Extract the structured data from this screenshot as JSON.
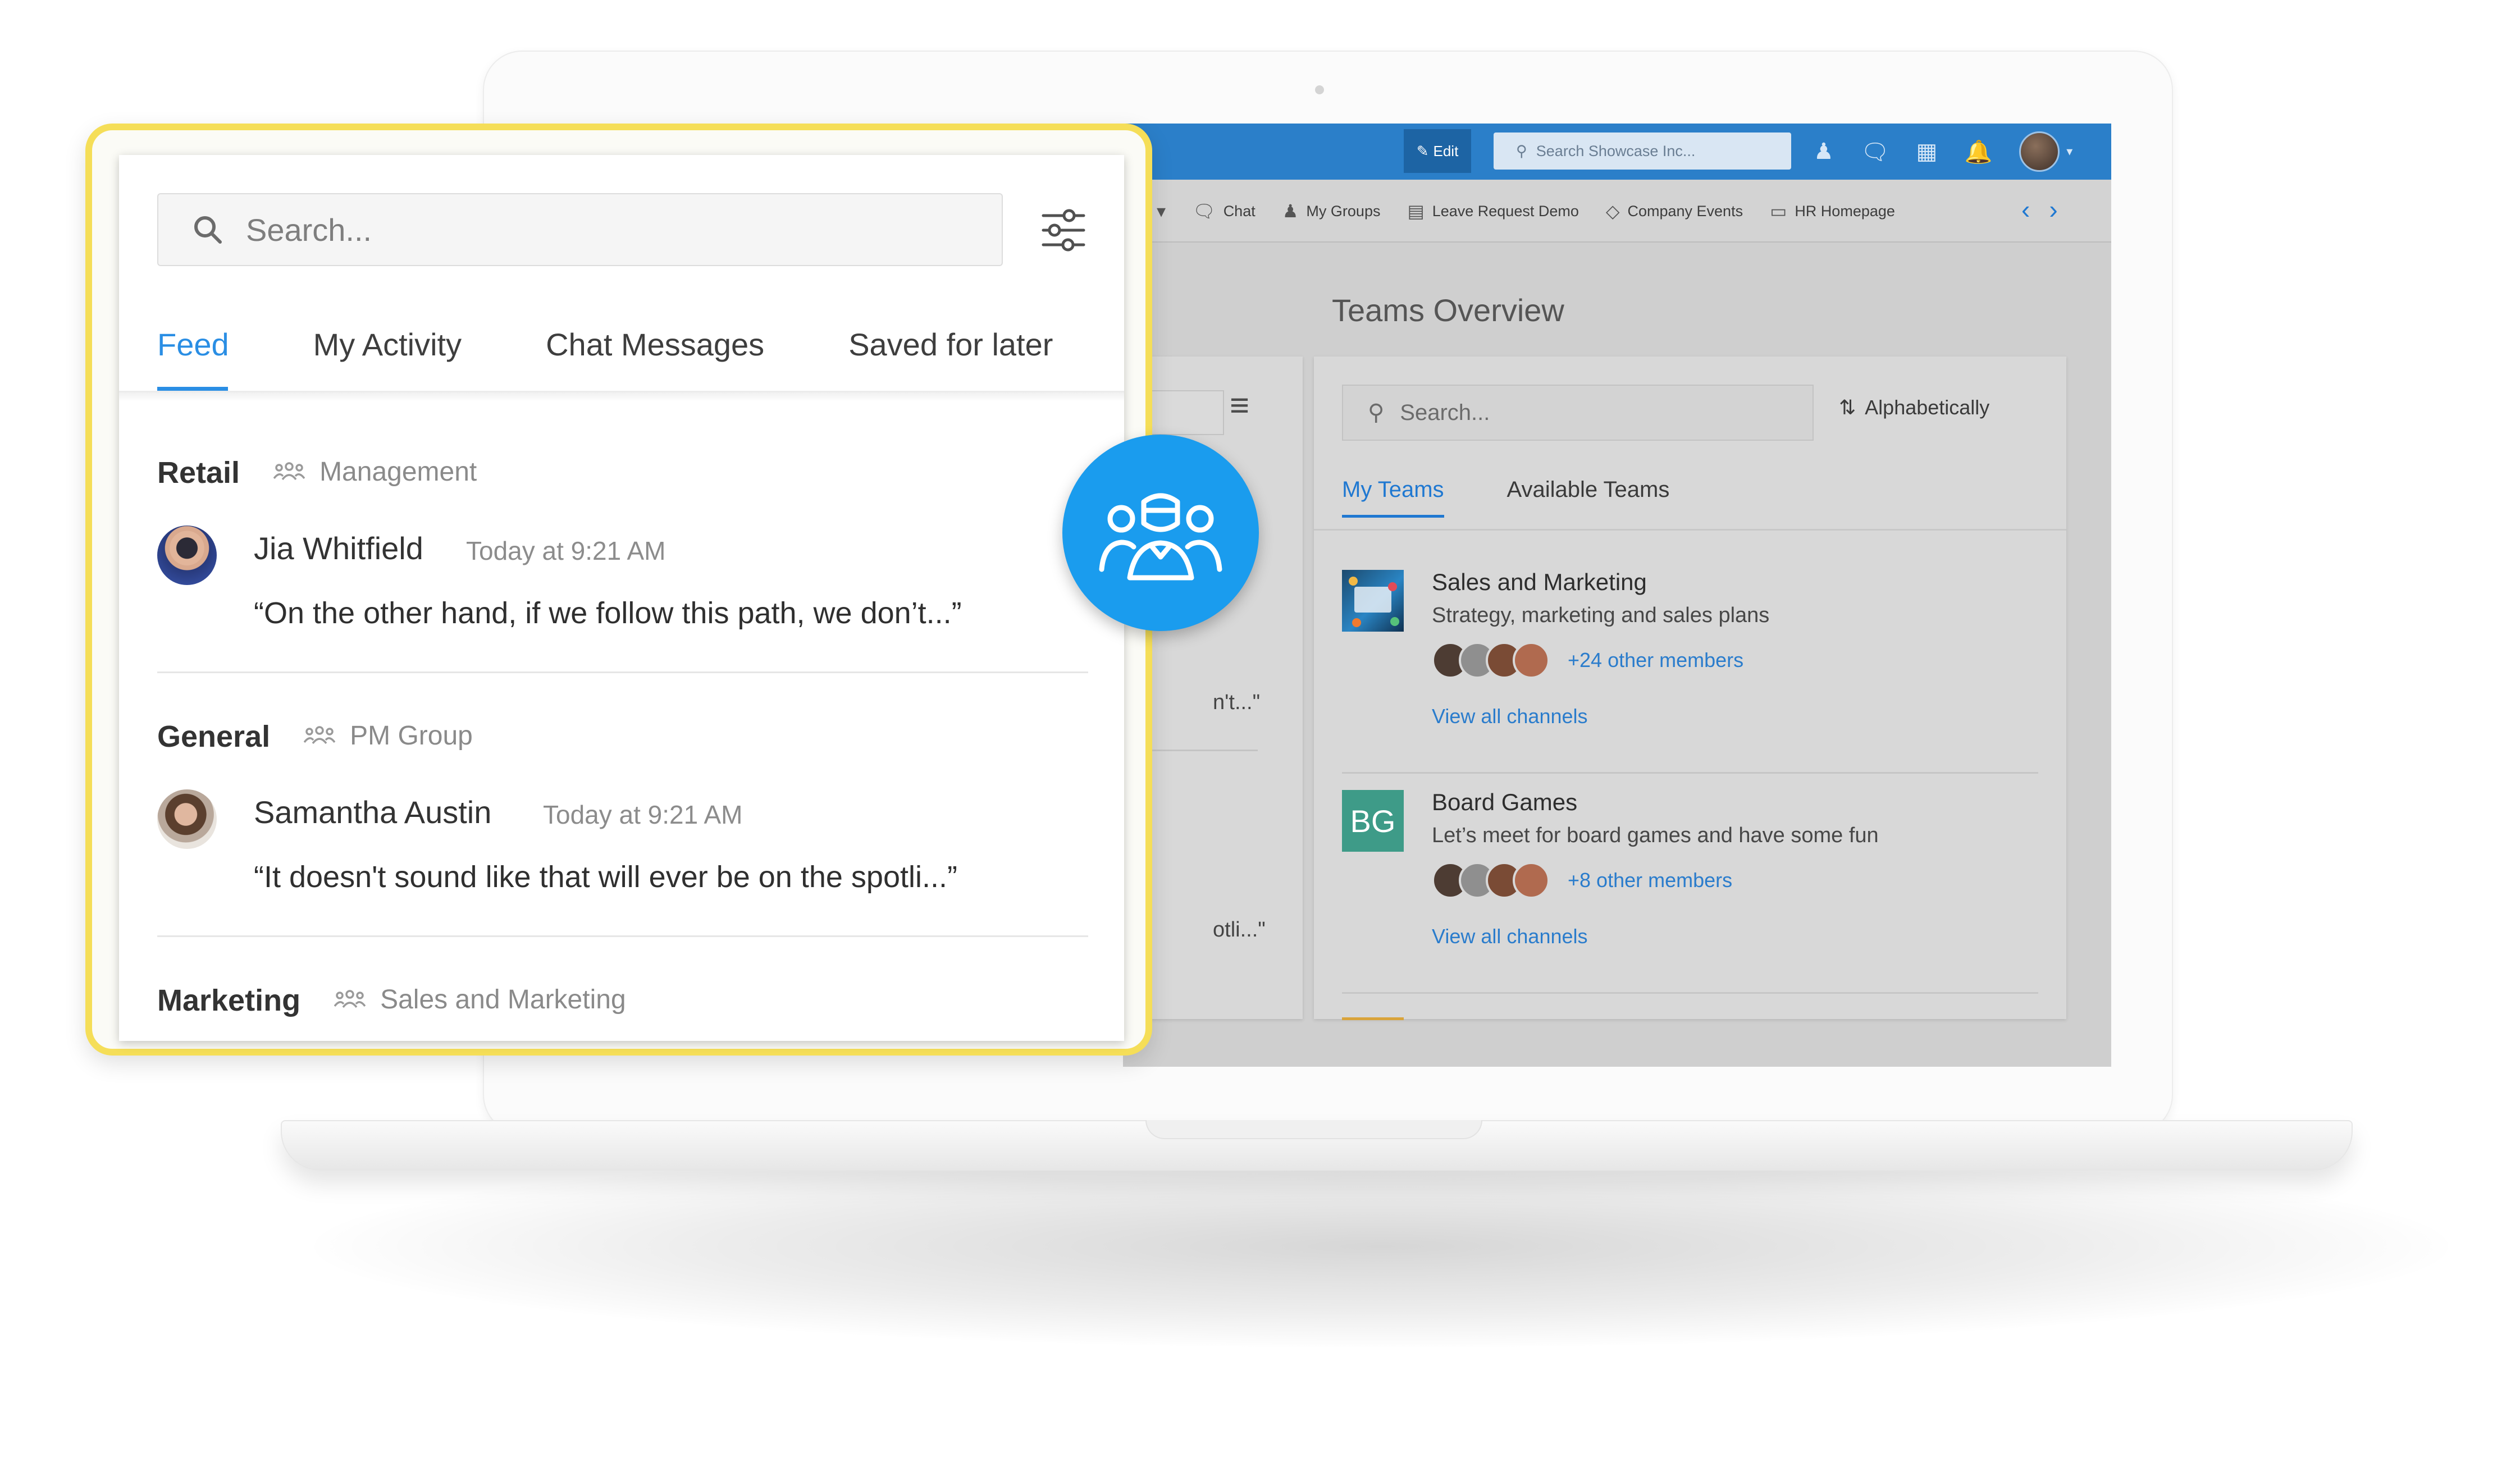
{
  "topbar": {
    "edit_label": "Edit",
    "search_placeholder": "Search Showcase Inc..."
  },
  "nav": {
    "items": [
      {
        "label": "Chat",
        "icon": "chat-icon"
      },
      {
        "label": "My Groups",
        "icon": "groups-icon"
      },
      {
        "label": "Leave Request Demo",
        "icon": "form-icon"
      },
      {
        "label": "Company Events",
        "icon": "tag-icon"
      },
      {
        "label": "HR Homepage",
        "icon": "page-icon"
      }
    ]
  },
  "teams_overview": {
    "title": "Teams Overview",
    "search_placeholder": "Search...",
    "sort_label": "Alphabetically",
    "tabs": [
      "My Teams",
      "Available Teams"
    ],
    "active_tab": "My Teams",
    "left_fragments": [
      "n't...\"",
      "otli...\""
    ],
    "teams": [
      {
        "name": "Sales and Marketing",
        "description": "Strategy, marketing and sales plans",
        "members_text": "+24 other members",
        "channels_link": "View all channels"
      },
      {
        "name": "Board Games",
        "initials": "BG",
        "description": "Let’s meet for board games and have some fun",
        "members_text": "+8 other members",
        "channels_link": "View all channels"
      }
    ]
  },
  "activity_panel": {
    "search_placeholder": "Search...",
    "tabs": [
      "Feed",
      "My Activity",
      "Chat Messages",
      "Saved for later"
    ],
    "active_tab": "Feed",
    "groups": [
      {
        "channel": "Retail",
        "team": "Management",
        "author": "Jia Whitfield",
        "time": "Today at 9:21 AM",
        "message": "“On the other hand, if we follow this path, we don’t...”"
      },
      {
        "channel": "General",
        "team": "PM Group",
        "author": "Samantha Austin",
        "time": "Today at 9:21 AM",
        "message": "“It doesn't sound like that will ever be on the spotli...”"
      },
      {
        "channel": "Marketing",
        "team": "Sales and Marketing"
      }
    ]
  },
  "colors": {
    "accent_blue": "#2a8ee4",
    "highlight_yellow": "#f5de58",
    "topbar_blue": "#2b7fc9",
    "badge_blue": "#1a9cee"
  }
}
